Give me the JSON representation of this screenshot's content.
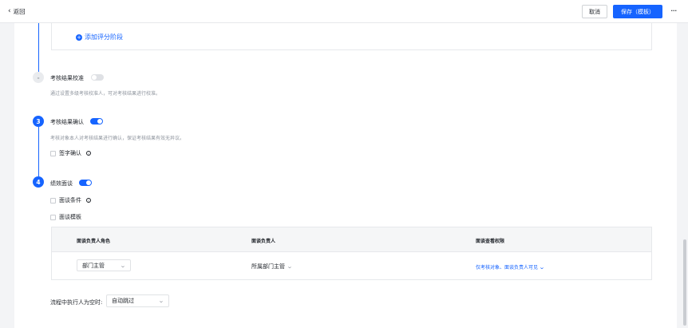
{
  "header": {
    "back_label": "返回",
    "cancel_label": "取消",
    "save_label": "保存（模板）",
    "more_label": "···"
  },
  "add_stage_label": "添加评分阶段",
  "steps": [
    {
      "number": "-",
      "title": "考核结果校准",
      "enabled": false,
      "description": "通过设置多级考核校准人，可对考核结果进行校准。"
    },
    {
      "number": "3",
      "title": "考核结果确认",
      "enabled": true,
      "description": "考核对象本人对考核结果进行确认，保证考核结果有效无异议。",
      "options": [
        "签字确认"
      ]
    },
    {
      "number": "4",
      "title": "绩效面谈",
      "enabled": true,
      "options": [
        "面谈条件",
        "面谈模板"
      ]
    }
  ],
  "interview_table": {
    "columns": [
      "面谈负责人角色",
      "面谈负责人",
      "面谈查看权限"
    ],
    "rows": [
      {
        "role": "部门主管",
        "owner": "所属部门主管",
        "permission": "仅考核对象、面谈负责人可见"
      }
    ]
  },
  "empty_executor": {
    "label": "流程中执行人为空时:",
    "value": "自动跳过"
  },
  "colors": {
    "accent": "#1664ff",
    "muted": "#8f959e"
  }
}
